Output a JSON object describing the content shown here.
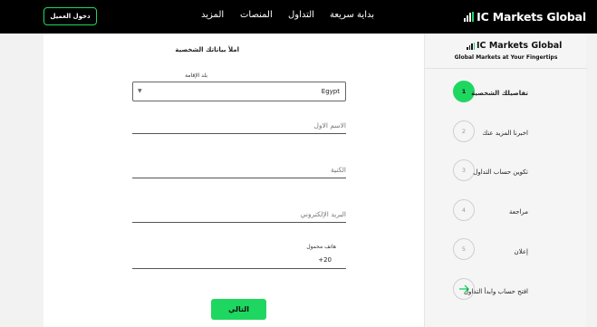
{
  "nav": {
    "login_label": "دخول العميل",
    "links": [
      "المزيد",
      "المنصات",
      "التداول",
      "بداية سريعة"
    ],
    "brand": "IC Markets Global"
  },
  "form": {
    "title": "املأ بياناتك الشخصية",
    "country_label": "بلد الإقامة",
    "country_value": "Egypt",
    "first_name_placeholder": "الاسم الاول",
    "last_name_placeholder": "الكنية",
    "email_placeholder": "البريد الإلكتروني",
    "phone_label": "هاتف محمول",
    "phone_prefix": "+20",
    "next_label": "التالي"
  },
  "panel": {
    "brand": "IC Markets Global",
    "tagline": "Global Markets at Your Fingertips",
    "steps": [
      {
        "number": "1",
        "label": "تفاصيلك الشخصية",
        "active": true
      },
      {
        "number": "2",
        "label": "اخبرنا المزيد عنك",
        "active": false
      },
      {
        "number": "3",
        "label": "تكوين حساب التداول",
        "active": false
      },
      {
        "number": "4",
        "label": "مراجعة",
        "active": false
      },
      {
        "number": "5",
        "label": "إعلان",
        "active": false
      },
      {
        "number": "",
        "icon": "arrow-right-icon",
        "label": "افتح حساب وابدأ التداول",
        "active": false
      }
    ]
  },
  "colors": {
    "accent": "#1ed760",
    "nav_bg": "#000000"
  }
}
